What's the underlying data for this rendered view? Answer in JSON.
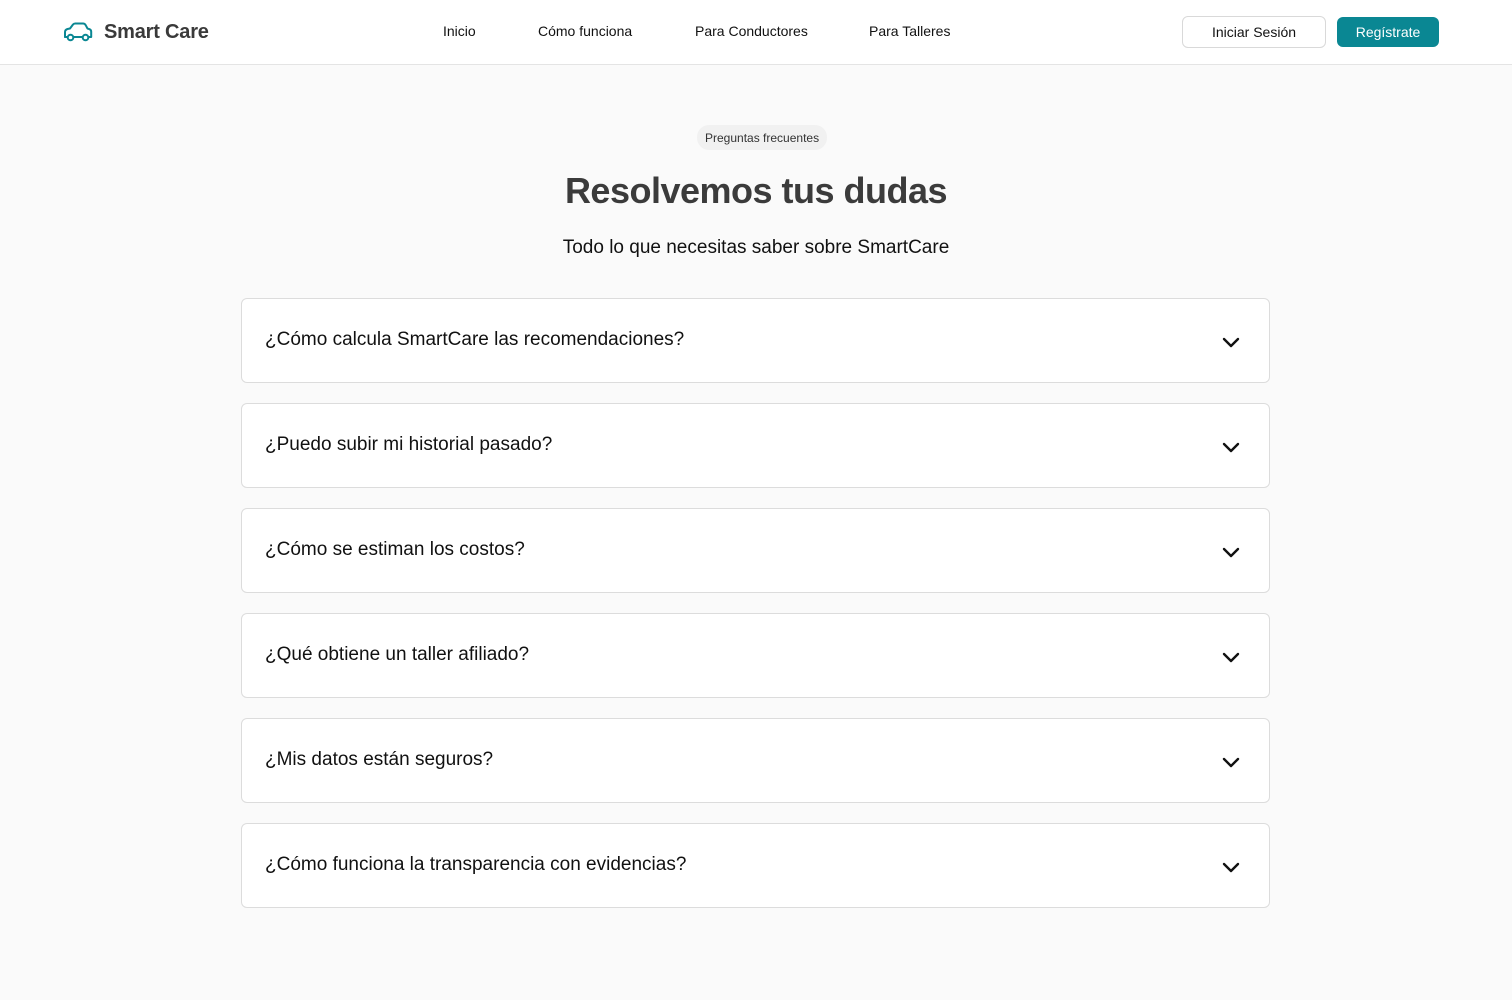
{
  "brand": {
    "name": "Smart Care",
    "accent_color": "#0a8793",
    "icon": "car-icon"
  },
  "nav": {
    "links": [
      {
        "label": "Inicio"
      },
      {
        "label": "Cómo funciona"
      },
      {
        "label": "Para Conductores"
      },
      {
        "label": "Para Talleres"
      }
    ],
    "login_label": "Iniciar Sesión",
    "register_label": "Regístrate"
  },
  "faq": {
    "badge": "Preguntas frecuentes",
    "title": "Resolvemos tus dudas",
    "subtitle": "Todo lo que necesitas saber sobre SmartCare",
    "items": [
      {
        "question": "¿Cómo calcula SmartCare las recomendaciones?",
        "expanded": false
      },
      {
        "question": "¿Puedo subir mi historial pasado?",
        "expanded": false
      },
      {
        "question": "¿Cómo se estiman los costos?",
        "expanded": false
      },
      {
        "question": "¿Qué obtiene un taller afiliado?",
        "expanded": false
      },
      {
        "question": "¿Mis datos están seguros?",
        "expanded": false
      },
      {
        "question": "¿Cómo funciona la transparencia con evidencias?",
        "expanded": false
      }
    ],
    "item_icon": "chevron-down-icon"
  }
}
